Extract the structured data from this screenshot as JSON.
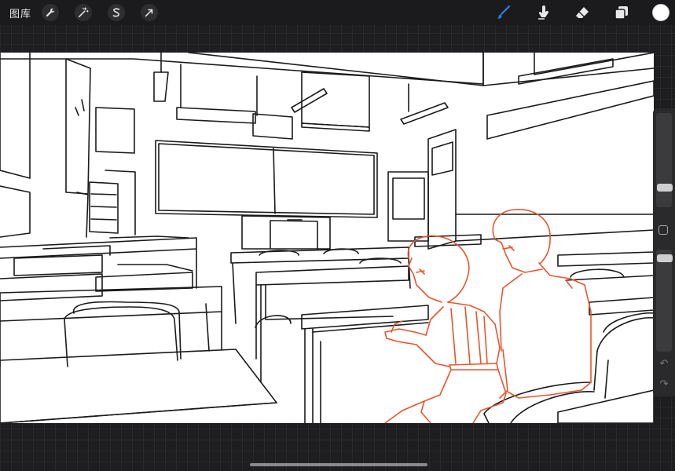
{
  "topbar": {
    "gallery_label": "图库",
    "left_tools": [
      {
        "name": "actions",
        "icon": "wrench-icon"
      },
      {
        "name": "adjustments",
        "icon": "magic-wand-icon"
      },
      {
        "name": "selection",
        "icon": "selection-s-icon"
      },
      {
        "name": "transform",
        "icon": "arrow-cursor-icon"
      }
    ],
    "right_tools": [
      {
        "name": "brush",
        "icon": "brush-icon",
        "active": true
      },
      {
        "name": "smudge",
        "icon": "smudge-finger-icon"
      },
      {
        "name": "eraser",
        "icon": "eraser-icon"
      },
      {
        "name": "layers",
        "icon": "layers-icon"
      }
    ],
    "current_color": "#ffffff"
  },
  "colors": {
    "active_tool": "#2f7de1",
    "sketch_line": "#1a1a1a",
    "figure_line": "#e8552e",
    "canvas_bg": "#ffffff"
  },
  "sidebar": {
    "brush_size_level": 0.8,
    "opacity_level": 0.95,
    "modify_icon": "square-icon",
    "undo_icon": "undo-icon",
    "redo_icon": "redo-icon"
  }
}
